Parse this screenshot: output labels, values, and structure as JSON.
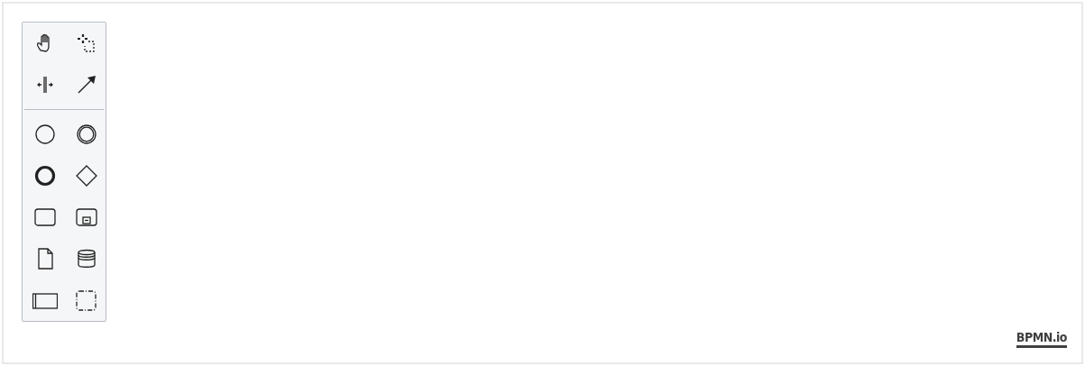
{
  "palette": {
    "groups": [
      {
        "tools": [
          {
            "kind": "hand"
          },
          {
            "kind": "lasso"
          },
          {
            "kind": "space"
          },
          {
            "kind": "connect"
          }
        ]
      },
      {
        "tools": [
          {
            "kind": "start-event"
          },
          {
            "kind": "intermediate-event"
          },
          {
            "kind": "end-event"
          },
          {
            "kind": "gateway"
          },
          {
            "kind": "task"
          },
          {
            "kind": "subprocess"
          },
          {
            "kind": "data-object"
          },
          {
            "kind": "data-store"
          },
          {
            "kind": "pool"
          },
          {
            "kind": "group"
          }
        ]
      }
    ]
  },
  "watermark_link": "BPMN.io"
}
